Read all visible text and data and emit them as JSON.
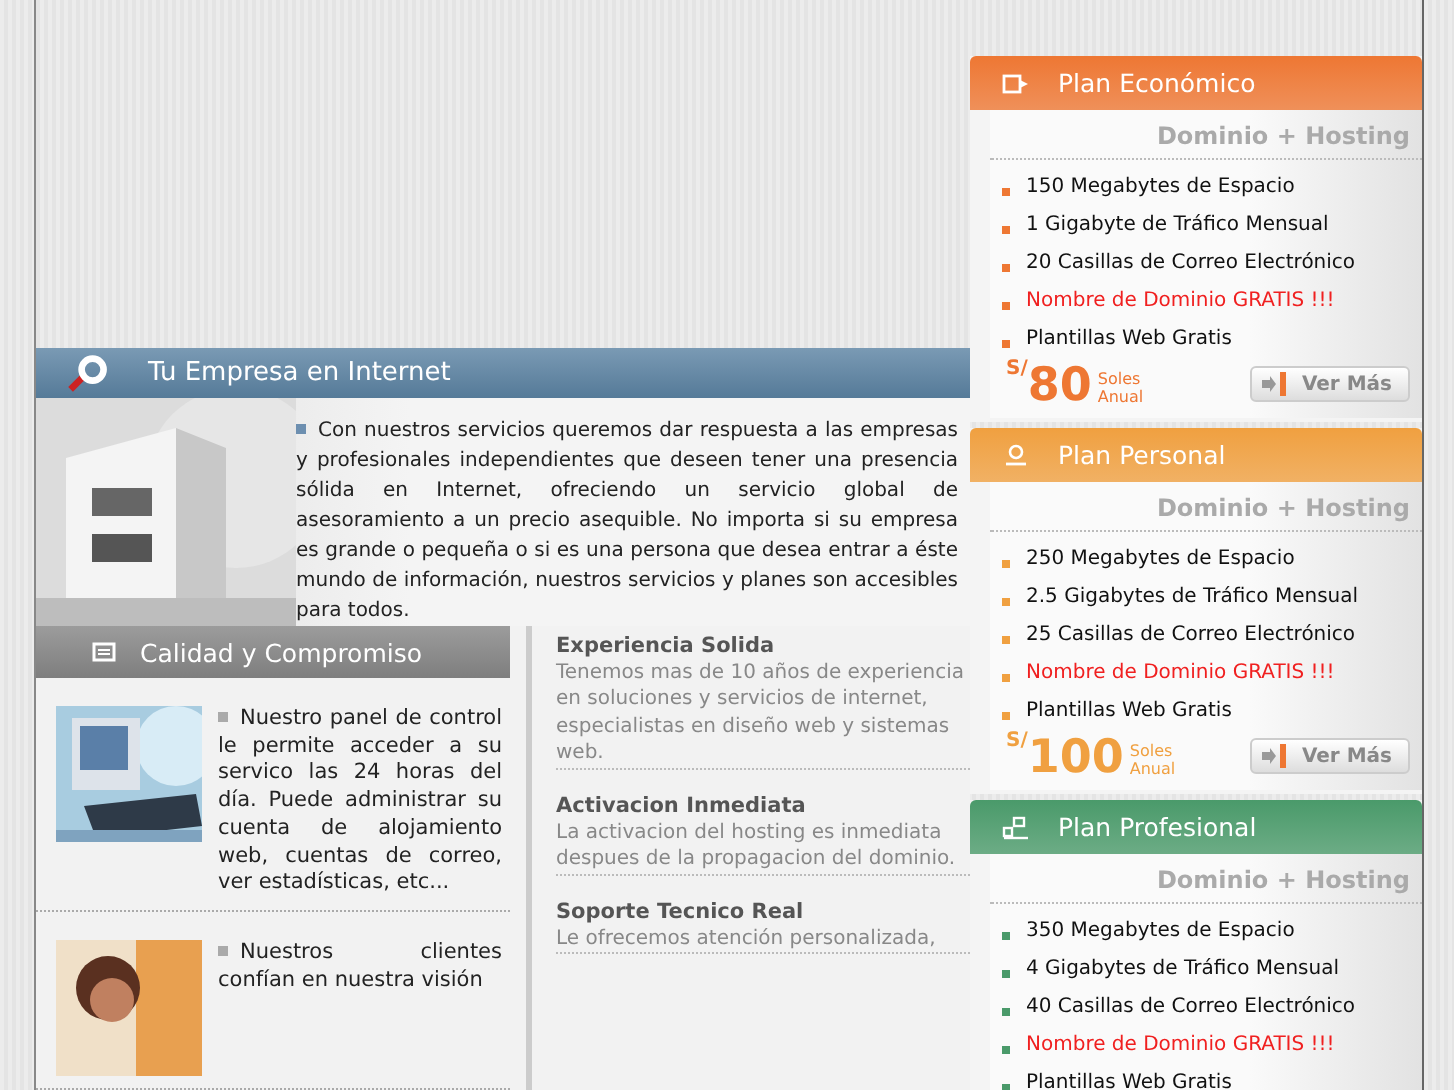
{
  "intro": {
    "title": "Tu Empresa en Internet",
    "text": "Con nuestros servicios queremos dar respuesta a las empresas y profesionales independientes que deseen tener una presencia sólida en Internet, ofreciendo un servicio global de asesoramiento a un precio asequible. No importa si su empresa es grande o pequeña o si es una persona que desea entrar a éste mundo de información, nuestros servicios y planes son accesibles para todos."
  },
  "quality": {
    "title": "Calidad y Compromiso",
    "items": [
      {
        "kind": "picture",
        "text": "Nuestro panel de control le permite acceder a su servico las 24 horas del día. Puede administrar su cuenta de alojamiento web, cuentas de correo, ver estadísticas, etc..."
      },
      {
        "kind": "picture",
        "text": "Nuestros clientes confían en nuestra visión"
      }
    ]
  },
  "features": [
    {
      "title": "**Experiencia** Solida",
      "text": "Tenemos mas de 10 años de experiencia en soluciones y servicios de internet, especialistas en diseño web y sistemas web."
    },
    {
      "title": "**Activacion** Inmediata",
      "text": "La activacion del hosting es inmediata despues de la propagacion del dominio."
    },
    {
      "title": "**Soporte** Tecnico Real",
      "text": "Le ofrecemos atención personalizada,"
    }
  ],
  "plans": [
    {
      "name": "Plan Económico",
      "color": "#ee7733",
      "subtitle": "Dominio + Hosting",
      "features": [
        {
          "text": "150 Megabytes de Espacio",
          "highlight": false
        },
        {
          "text": "1 Gigabyte de Tráfico Mensual",
          "highlight": false
        },
        {
          "text": "20 Casillas de Correo Electrónico",
          "highlight": false
        },
        {
          "text": "Nombre de Dominio GRATIS !!!",
          "highlight": true
        },
        {
          "text": "Plantillas Web Gratis",
          "highlight": false
        }
      ],
      "currency": "S/",
      "price": "80",
      "unit": "Soles",
      "period": "Anual",
      "button": "Ver Más"
    },
    {
      "name": "Plan Personal",
      "color": "#f0a040",
      "subtitle": "Dominio + Hosting",
      "features": [
        {
          "text": "250 Megabytes de Espacio",
          "highlight": false
        },
        {
          "text": "2.5 Gigabytes de Tráfico Mensual",
          "highlight": false
        },
        {
          "text": "25 Casillas de Correo Electrónico",
          "highlight": false
        },
        {
          "text": "Nombre de Dominio GRATIS !!!",
          "highlight": true
        },
        {
          "text": "Plantillas Web Gratis",
          "highlight": false
        }
      ],
      "currency": "S/",
      "price": "100",
      "unit": "Soles",
      "period": "Anual",
      "button": "Ver Más"
    },
    {
      "name": "Plan Profesional",
      "color": "#4a9a6a",
      "subtitle": "Dominio + Hosting",
      "features": [
        {
          "text": "350 Megabytes de Espacio",
          "highlight": false
        },
        {
          "text": "4 Gigabytes de Tráfico Mensual",
          "highlight": false
        },
        {
          "text": "40 Casillas de Correo Electrónico",
          "highlight": false
        },
        {
          "text": "Nombre de Dominio GRATIS !!!",
          "highlight": true
        },
        {
          "text": "Plantillas Web Gratis",
          "highlight": false
        }
      ]
    }
  ]
}
